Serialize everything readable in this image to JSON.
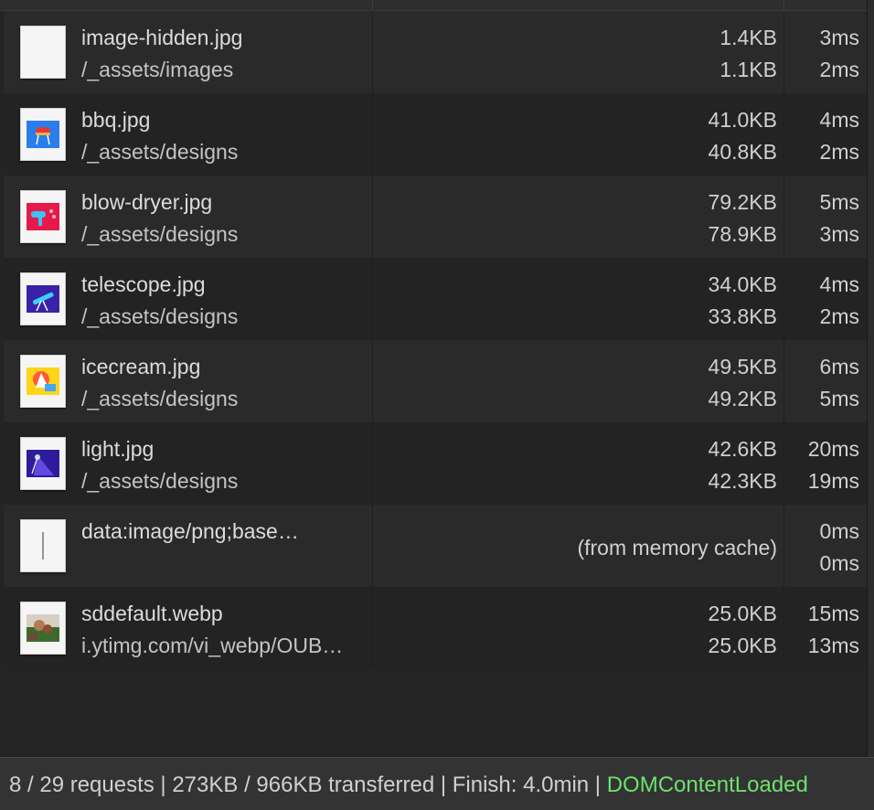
{
  "requests": [
    {
      "name": "image-hidden.jpg",
      "path": "/_assets/images",
      "size": "1.4KB",
      "content": "1.1KB",
      "time": "3ms",
      "latency": "2ms",
      "thumb": "blank"
    },
    {
      "name": "bbq.jpg",
      "path": "/_assets/designs",
      "size": "41.0KB",
      "content": "40.8KB",
      "time": "4ms",
      "latency": "2ms",
      "thumb": "bbq"
    },
    {
      "name": "blow-dryer.jpg",
      "path": "/_assets/designs",
      "size": "79.2KB",
      "content": "78.9KB",
      "time": "5ms",
      "latency": "3ms",
      "thumb": "dryer"
    },
    {
      "name": "telescope.jpg",
      "path": "/_assets/designs",
      "size": "34.0KB",
      "content": "33.8KB",
      "time": "4ms",
      "latency": "2ms",
      "thumb": "telescope"
    },
    {
      "name": "icecream.jpg",
      "path": "/_assets/designs",
      "size": "49.5KB",
      "content": "49.2KB",
      "time": "6ms",
      "latency": "5ms",
      "thumb": "icecream"
    },
    {
      "name": "light.jpg",
      "path": "/_assets/designs",
      "size": "42.6KB",
      "content": "42.3KB",
      "time": "20ms",
      "latency": "19ms",
      "thumb": "light"
    },
    {
      "name": "data:image/png;base…",
      "path": "",
      "cache": "(from memory cache)",
      "time": "0ms",
      "latency": "0ms",
      "thumb": "line"
    },
    {
      "name": "sddefault.webp",
      "path": "i.ytimg.com/vi_webp/OUB…",
      "size": "25.0KB",
      "content": "25.0KB",
      "time": "15ms",
      "latency": "13ms",
      "thumb": "photo"
    }
  ],
  "footer": {
    "summary": "8 / 29 requests | 273KB / 966KB transferred | Finish: 4.0min | ",
    "dcl": "DOMContentLoaded",
    "dcl_color": "#6ee06e"
  },
  "colors": {
    "bg": "#242424",
    "row_even": "#2a2a2a",
    "row_odd": "#232323",
    "footer": "#333333"
  }
}
